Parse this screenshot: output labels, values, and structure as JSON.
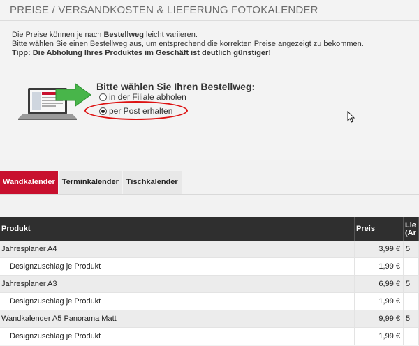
{
  "page": {
    "title": "PREISE / VERSANDKOSTEN & LIEFERUNG FOTOKALENDER"
  },
  "info": {
    "line1_pre": "Die Preise können je nach ",
    "line1_bold": "Bestellweg",
    "line1_post": " leicht variieren.",
    "line2": "Bitte wählen Sie einen Bestellweg aus, um entsprechend die korrekten Preise angezeigt zu bekommen.",
    "tip": "Tipp: Die Abholung Ihres Produktes im Geschäft ist deutlich günstiger!"
  },
  "order_method": {
    "heading": "Bitte wählen Sie Ihren Bestellweg:",
    "options": [
      {
        "label": "in der Filiale abholen",
        "checked": false
      },
      {
        "label": "per Post erhalten",
        "checked": true
      }
    ]
  },
  "tabs": [
    {
      "label": "Wandkalender",
      "active": true
    },
    {
      "label": "Terminkalender",
      "active": false
    },
    {
      "label": "Tischkalender",
      "active": false
    }
  ],
  "table": {
    "headers": {
      "product": "Produkt",
      "price": "Preis",
      "delivery_line1": "Lie",
      "delivery_line2": "(Ar"
    },
    "rows": [
      {
        "name": "Jahresplaner A4",
        "price": "3,99 €",
        "days": "5",
        "sub": false
      },
      {
        "name": "Designzuschlag je Produkt",
        "price": "1,99 €",
        "days": "",
        "sub": true
      },
      {
        "name": "Jahresplaner A3",
        "price": "6,99 €",
        "days": "5",
        "sub": false
      },
      {
        "name": "Designzuschlag je Produkt",
        "price": "1,99 €",
        "days": "",
        "sub": true
      },
      {
        "name": "Wandkalender A5 Panorama Matt",
        "price": "9,99 €",
        "days": "5",
        "sub": false
      },
      {
        "name": "Designzuschlag je Produkt",
        "price": "1,99 €",
        "days": "",
        "sub": true
      }
    ]
  },
  "colors": {
    "accent": "#c8102e",
    "header_bg": "#2f2f2f",
    "highlight": "#dd1111"
  }
}
